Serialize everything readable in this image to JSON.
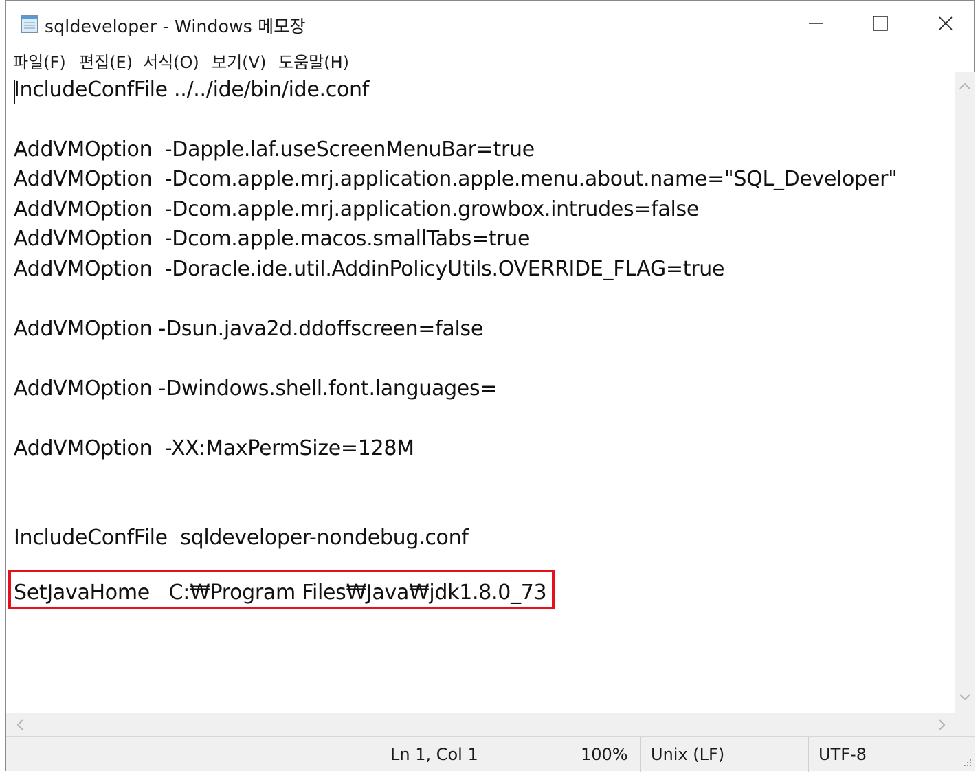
{
  "window": {
    "title": "sqldeveloper - Windows 메모장",
    "icon": "notepad-icon"
  },
  "menu": [
    "파일(F)",
    "편집(E)",
    "서식(O)",
    "보기(V)",
    "도움말(H)"
  ],
  "editor": {
    "lines": [
      "IncludeConfFile ../../ide/bin/ide.conf",
      "AddVMOption  -Dapple.laf.useScreenMenuBar=true",
      "AddVMOption  -Dcom.apple.mrj.application.apple.menu.about.name=\"SQL_Developer\"",
      "AddVMOption  -Dcom.apple.mrj.application.growbox.intrudes=false",
      "AddVMOption  -Dcom.apple.macos.smallTabs=true",
      "AddVMOption  -Doracle.ide.util.AddinPolicyUtils.OVERRIDE_FLAG=true",
      "AddVMOption -Dsun.java2d.ddoffscreen=false",
      "AddVMOption -Dwindows.shell.font.languages=",
      "AddVMOption  -XX:MaxPermSize=128M",
      "IncludeConfFile  sqldeveloper-nondebug.conf",
      "SetJavaHome   C:₩Program Files₩Java₩jdk1.8.0_73"
    ],
    "highlight_color": "#e5101d"
  },
  "status": {
    "position": "Ln 1, Col 1",
    "zoom": "100%",
    "line_ending": "Unix (LF)",
    "encoding": "UTF-8"
  }
}
